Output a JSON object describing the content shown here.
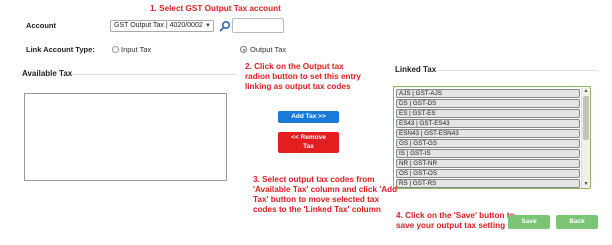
{
  "annotations": {
    "step1": "1. Select GST Output Tax account",
    "step2": [
      "2. Click on the Output tax",
      "radion button to set this entry",
      "linking as output tax codes"
    ],
    "step3": [
      "3. Select output tax codes from",
      "'Available Tax' column and click 'Add",
      "Tax' button to move selected tax",
      "codes to the 'Linked Tax' column"
    ],
    "step4": [
      "4. Click on the 'Save' button to",
      "save your output tax setting"
    ]
  },
  "form": {
    "account_label": "Account",
    "account_value": "GST Output Tax | 4020/0002",
    "account_input_value": "",
    "link_type_label": "Link Account Type:",
    "radio_input_label": "Input Tax",
    "radio_output_label": "Output Tax",
    "selected_link_type": "Output Tax"
  },
  "available_tax": {
    "title": "Available Tax",
    "items": []
  },
  "buttons": {
    "add": "Add Tax >>",
    "remove": [
      "<< Remove",
      "Tax"
    ],
    "save": "Save",
    "back": "Back"
  },
  "linked_tax": {
    "title": "Linked Tax",
    "items": [
      "AJS | GST-AJS",
      "DS | GST-DS",
      "ES | GST-ES",
      "ES43 | GST-ES43",
      "ESN43 | GST-ESN43",
      "GS | GST-GS",
      "IS | GST-IS",
      "NR | GST-NR",
      "OS | GST-OS",
      "RS | GST-RS"
    ]
  },
  "colors": {
    "annotation": "#e02020",
    "add_button": "#1a7ad8",
    "remove_button": "#e41e1e",
    "save_back_button": "#7cc576",
    "linked_border": "#8cba54"
  }
}
